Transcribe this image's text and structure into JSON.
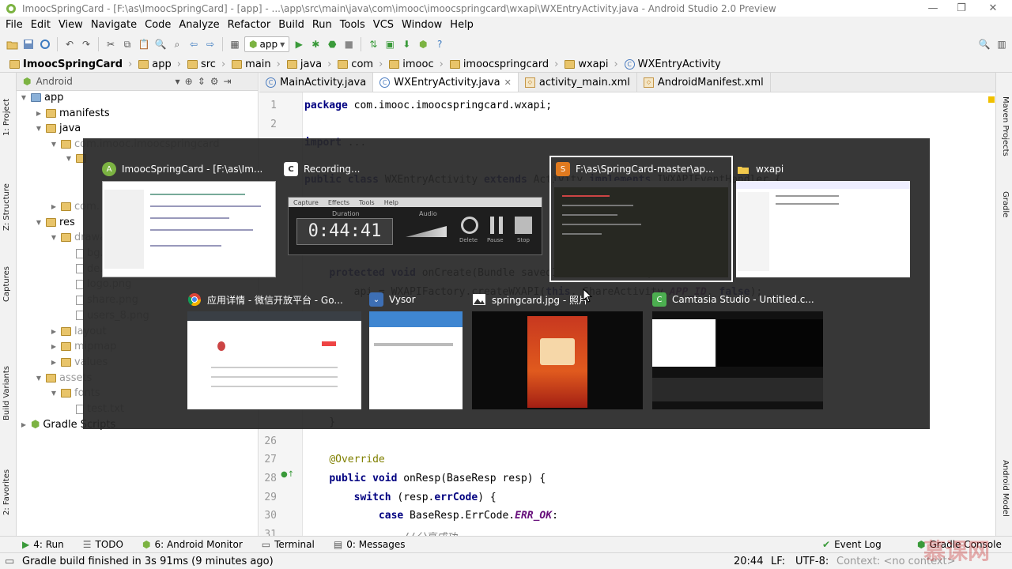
{
  "titlebar": {
    "title": "ImoocSpringCard - [F:\\as\\ImoocSpringCard] - [app] - ...\\app\\src\\main\\java\\com\\imooc\\imoocspringcard\\wxapi\\WXEntryActivity.java - Android Studio 2.0 Preview",
    "minimize": "—",
    "restore": "❐",
    "close": "✕"
  },
  "menu": [
    "File",
    "Edit",
    "View",
    "Navigate",
    "Code",
    "Analyze",
    "Refactor",
    "Build",
    "Run",
    "Tools",
    "VCS",
    "Window",
    "Help"
  ],
  "toolbar": {
    "run_config": "app"
  },
  "breadcrumbs": [
    "ImoocSpringCard",
    "app",
    "src",
    "main",
    "java",
    "com",
    "imooc",
    "imoocspringcard",
    "wxapi",
    "WXEntryActivity"
  ],
  "left_tools": [
    "1: Project",
    "Z: Structure",
    "Captures",
    "Build Variants",
    "2: Favorites"
  ],
  "right_tools": [
    "Maven Projects",
    "Gradle",
    "Android Model"
  ],
  "project": {
    "view": "Android",
    "tree": [
      {
        "label": "app",
        "depth": 0,
        "icon": "module",
        "dim": false
      },
      {
        "label": "manifests",
        "depth": 1,
        "icon": "folder",
        "dim": false
      },
      {
        "label": "java",
        "depth": 1,
        "icon": "folder",
        "dim": false
      },
      {
        "label": "com.imooc.imoocspringcard",
        "depth": 2,
        "icon": "package",
        "dim": true
      },
      {
        "label": "",
        "depth": 3,
        "icon": "package",
        "dim": true
      },
      {
        "label": "",
        "depth": 4,
        "icon": "none",
        "dim": true
      },
      {
        "label": "",
        "depth": 4,
        "icon": "none",
        "dim": true
      },
      {
        "label": "com.",
        "depth": 2,
        "icon": "package",
        "dim": true
      },
      {
        "label": "res",
        "depth": 1,
        "icon": "folder",
        "dim": false
      },
      {
        "label": "drawable",
        "depth": 2,
        "icon": "folder",
        "dim": true
      },
      {
        "label": "bg.",
        "depth": 3,
        "icon": "file",
        "dim": true
      },
      {
        "label": "de.",
        "depth": 3,
        "icon": "file",
        "dim": true
      },
      {
        "label": "logo.png",
        "depth": 3,
        "icon": "file",
        "dim": true
      },
      {
        "label": "share.png",
        "depth": 3,
        "icon": "file",
        "dim": true
      },
      {
        "label": "users_8.png",
        "depth": 3,
        "icon": "file",
        "dim": true
      },
      {
        "label": "layout",
        "depth": 2,
        "icon": "folder",
        "dim": true
      },
      {
        "label": "mipmap",
        "depth": 2,
        "icon": "folder",
        "dim": true
      },
      {
        "label": "values",
        "depth": 2,
        "icon": "folder",
        "dim": true
      },
      {
        "label": "assets",
        "depth": 1,
        "icon": "folder",
        "dim": true
      },
      {
        "label": "fonts",
        "depth": 2,
        "icon": "folder",
        "dim": true
      },
      {
        "label": "test.txt",
        "depth": 3,
        "icon": "file",
        "dim": true
      },
      {
        "label": "Gradle Scripts",
        "depth": 0,
        "icon": "gradle",
        "dim": false
      }
    ]
  },
  "tabs": [
    {
      "label": "MainActivity.java",
      "icon": "C",
      "active": false,
      "closable": false
    },
    {
      "label": "WXEntryActivity.java",
      "icon": "C",
      "active": true,
      "closable": true
    },
    {
      "label": "activity_main.xml",
      "icon": "xml",
      "active": false,
      "closable": false
    },
    {
      "label": "AndroidManifest.xml",
      "icon": "xml",
      "active": false,
      "closable": false
    }
  ],
  "code_lines": [
    {
      "n": "1",
      "html": "<span class=\"kw\">package</span> com.imooc.imoocspringcard.wxapi;"
    },
    {
      "n": "2",
      "html": ""
    },
    {
      "n": "",
      "html": "<span class=\"kw\">import</span> ..."
    },
    {
      "n": "",
      "html": ""
    },
    {
      "n": "",
      "html": "<span class=\"kw\">public class</span> WXEntryActivity <span class=\"kw\">extends</span> Activity <span class=\"kw\">implements</span> IWXAPIEventHandler {"
    },
    {
      "n": "",
      "html": ""
    },
    {
      "n": "",
      "html": ""
    },
    {
      "n": "",
      "html": ""
    },
    {
      "n": "",
      "html": ""
    },
    {
      "n": "",
      "html": "    <span class=\"kw\">protected void</span> onCreate(Bundle savedInstanceState) {"
    },
    {
      "n": "",
      "html": "        api = WXAPIFactory.createWXAPI(<span class=\"kw\">this</span>, ShareActivity.<span class=\"fld2\">APP_ID</span>, <span class=\"kw\">false</span>);"
    },
    {
      "n": "",
      "html": ""
    },
    {
      "n": "",
      "html": ""
    },
    {
      "n": "",
      "html": ""
    },
    {
      "n": "",
      "html": ""
    },
    {
      "n": "",
      "html": ""
    },
    {
      "n": "",
      "html": ""
    },
    {
      "n": "",
      "html": "    }"
    },
    {
      "n": "26",
      "html": ""
    },
    {
      "n": "27",
      "html": "    <span class=\"an\">@Override</span>"
    },
    {
      "n": "28",
      "html": "    <span class=\"kw\">public void</span> onResp(BaseResp resp) {"
    },
    {
      "n": "29",
      "html": "        <span class=\"kw\">switch</span> (resp.<span class=\"kw\">errCode</span>) {"
    },
    {
      "n": "30",
      "html": "            <span class=\"kw\">case</span> BaseResp.ErrCode.<span class=\"fld2\">ERR_OK</span>:"
    },
    {
      "n": "31",
      "html": "                <span class=\"cm\">//分享成功</span>"
    }
  ],
  "tool_windows": [
    {
      "label": "4: Run",
      "icon": "▶",
      "color": "#3a9a3a"
    },
    {
      "label": "TODO",
      "icon": "☰",
      "color": "#666"
    },
    {
      "label": "6: Android Monitor",
      "icon": "⬢",
      "color": "#7cb342"
    },
    {
      "label": "Terminal",
      "icon": "▭",
      "color": "#555"
    },
    {
      "label": "0: Messages",
      "icon": "▤",
      "color": "#555"
    }
  ],
  "right_tool_windows": [
    {
      "label": "Event Log",
      "icon": "✔"
    },
    {
      "label": "Gradle Console",
      "icon": "⬢"
    }
  ],
  "status": {
    "message": "Gradle build finished in 3s 91ms (9 minutes ago)",
    "position": "20:44",
    "line_sep": "LF:",
    "encoding": "UTF-8:",
    "context": "Context: <no context>"
  },
  "task_switcher": {
    "windows": [
      {
        "title": "ImoocSpringCard - [F:\\as\\Im...",
        "icon": "android-studio-icon",
        "selected": false
      },
      {
        "title": "Recording...",
        "icon": "camtasia-recorder-icon",
        "selected": false
      },
      {
        "title": "F:\\as\\SpringCard-master\\ap...",
        "icon": "sublime-icon",
        "selected": true
      },
      {
        "title": "wxapi",
        "icon": "folder-icon",
        "selected": false
      },
      {
        "title": "应用详情 - 微信开放平台 - Go...",
        "icon": "chrome-icon",
        "selected": false
      },
      {
        "title": "Vysor",
        "icon": "vysor-icon",
        "selected": false
      },
      {
        "title": "springcard.jpg - 照片",
        "icon": "photos-icon",
        "selected": false
      },
      {
        "title": "Camtasia Studio - Untitled.c...",
        "icon": "camtasia-icon",
        "selected": false
      }
    ],
    "recorder": {
      "menu": [
        "Capture",
        "Effects",
        "Tools",
        "Help"
      ],
      "duration_label": "Duration",
      "duration": "0:44:41",
      "audio_label": "Audio",
      "buttons": [
        "Delete",
        "Pause",
        "Stop"
      ]
    }
  },
  "watermark": "慕课网"
}
